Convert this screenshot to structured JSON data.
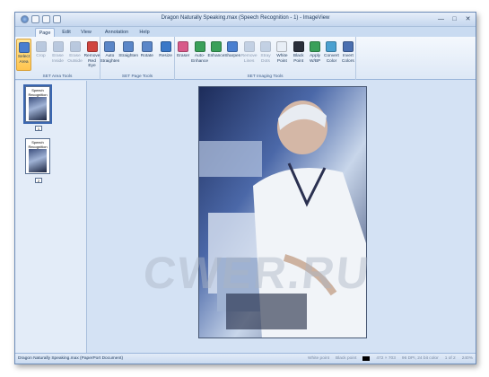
{
  "window": {
    "title": "Dragon Naturally Speaking.max (Speech Recognition - 1) - ImageView",
    "controls": [
      "—",
      "□",
      "✕"
    ]
  },
  "tabs": [
    {
      "label": "Page",
      "active": true
    },
    {
      "label": "Edit",
      "active": false
    },
    {
      "label": "View",
      "active": false
    },
    {
      "label": "Annotation",
      "active": false
    },
    {
      "label": "Help",
      "active": false
    }
  ],
  "ribbon": {
    "groups": [
      {
        "title": "SET Area Tools",
        "tools": [
          {
            "label": "Select\nArea",
            "icon": "select-area-icon",
            "color": "#4a7fd0",
            "selected": true
          },
          {
            "label": "Crop",
            "icon": "crop-icon",
            "color": "#7a95bd",
            "disabled": true
          },
          {
            "label": "Erase\nInside",
            "icon": "erase-inside-icon",
            "color": "#7a95bd",
            "disabled": true
          },
          {
            "label": "Erase\nOutside",
            "icon": "erase-outside-icon",
            "color": "#7a95bd",
            "disabled": true
          },
          {
            "label": "Remove\nRed Eye",
            "icon": "red-eye-icon",
            "color": "#d0453f"
          }
        ]
      },
      {
        "title": "SET Page Tools",
        "tools": [
          {
            "label": "Auto\nStraighten",
            "icon": "auto-straighten-icon",
            "color": "#5a86c8"
          },
          {
            "label": "Straighten",
            "icon": "straighten-icon",
            "color": "#5a86c8"
          },
          {
            "label": "Rotate",
            "icon": "rotate-icon",
            "color": "#5a86c8"
          },
          {
            "label": "Resize",
            "icon": "resize-icon",
            "color": "#3a78c8"
          }
        ]
      },
      {
        "title": "SET Imaging Tools",
        "tools": [
          {
            "label": "Eraser",
            "icon": "eraser-icon",
            "color": "#d85a8a"
          },
          {
            "label": "Auto-Enhance",
            "icon": "auto-enhance-icon",
            "color": "#3aa05a"
          },
          {
            "label": "Enhance",
            "icon": "enhance-icon",
            "color": "#3aa05a"
          },
          {
            "label": "Sharpen",
            "icon": "sharpen-icon",
            "color": "#4a7fd0"
          },
          {
            "label": "Remove\nLines",
            "icon": "remove-lines-icon",
            "color": "#8ea6c8",
            "disabled": true
          },
          {
            "label": "Stray\nDots",
            "icon": "stray-dots-icon",
            "color": "#8ea6c8",
            "disabled": true
          },
          {
            "label": "White\nPoint",
            "icon": "white-point-icon",
            "color": "#e8eef6"
          },
          {
            "label": "Black\nPoint",
            "icon": "black-point-icon",
            "color": "#2a2f3a"
          },
          {
            "label": "Apply\nW/BP",
            "icon": "apply-wbp-icon",
            "color": "#3aa05a"
          },
          {
            "label": "Convert\nColor",
            "icon": "convert-color-icon",
            "color": "#4aa0d0"
          },
          {
            "label": "Invert\nColors",
            "icon": "invert-colors-icon",
            "color": "#4a6fb0"
          }
        ]
      }
    ]
  },
  "thumbnails": [
    {
      "caption": "Speech\nRecognition",
      "page": "1",
      "selected": true
    },
    {
      "caption": "Speech\nRecognition",
      "page": "2",
      "selected": false
    }
  ],
  "statusbar": {
    "document": "Dragon Naturally Speaking.max (PaperPort Document)",
    "white_point": "White point",
    "black_point": "Black point",
    "dimensions": "472 × 703",
    "color_depth": "96 DPI, 24 bit color",
    "page": "1 of 2",
    "zoom": "240%"
  },
  "watermark": "CWER.RU"
}
